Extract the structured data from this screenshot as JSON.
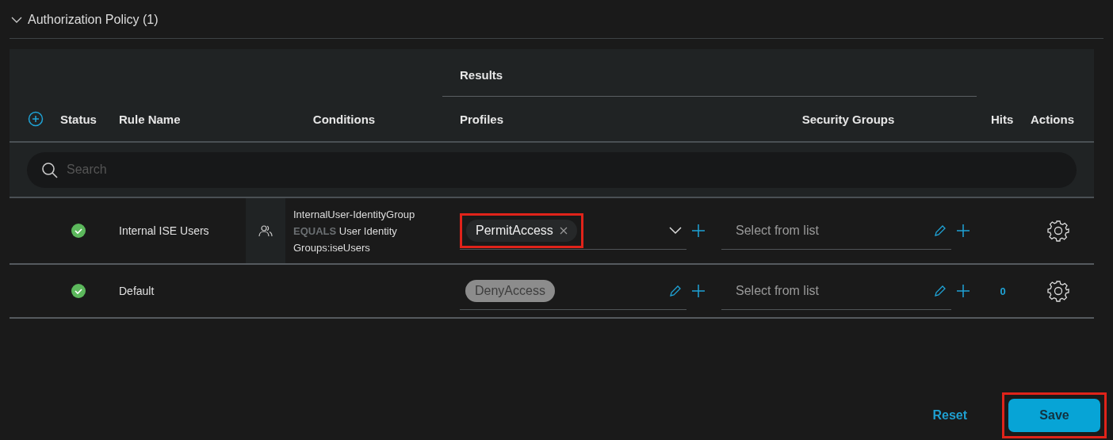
{
  "section": {
    "title": "Authorization Policy (1)",
    "expanded": true
  },
  "table": {
    "group_header": "Results",
    "columns": [
      "Status",
      "Rule Name",
      "Conditions",
      "Profiles",
      "Security Groups",
      "Hits",
      "Actions"
    ],
    "search": {
      "placeholder": "Search"
    },
    "rows": [
      {
        "enabled": true,
        "name": "Internal ISE Users",
        "conditions": {
          "attribute": "InternalUser-IdentityGroup",
          "operator": "EQUALS",
          "value": "User Identity Groups:iseUsers"
        },
        "profile": {
          "label": "PermitAccess",
          "removable": true,
          "highlighted": true,
          "kind": "dropdown"
        },
        "security_group": {
          "placeholder": "Select from list"
        }
      },
      {
        "enabled": true,
        "name": "Default",
        "profile": {
          "label": "DenyAccess",
          "removable": false,
          "highlighted": false,
          "kind": "edit"
        },
        "security_group": {
          "placeholder": "Select from list"
        },
        "hits": "0"
      }
    ]
  },
  "footer": {
    "reset": "Reset",
    "save": {
      "label": "Save",
      "highlighted": true
    }
  }
}
